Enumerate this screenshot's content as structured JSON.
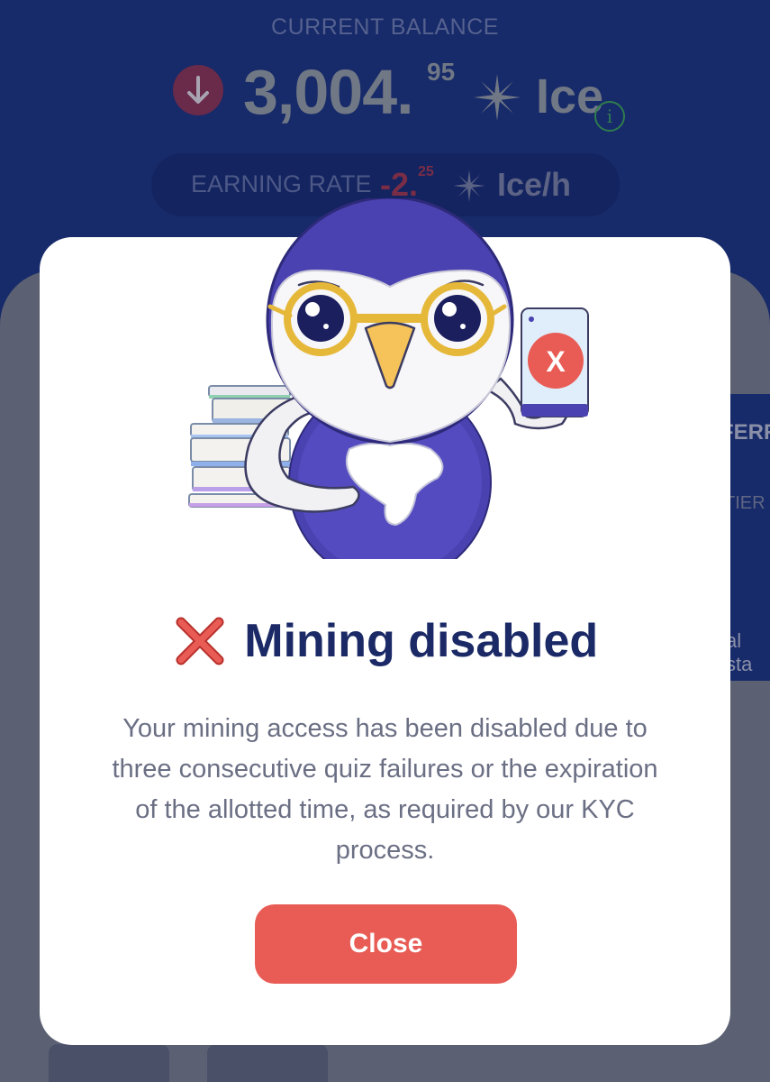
{
  "balance": {
    "label": "CURRENT BALANCE",
    "integer": "3,004.",
    "decimal": "95",
    "unit": "Ice",
    "trend": "down",
    "info_icon_glyph": "i"
  },
  "earning_rate": {
    "label": "EARNING RATE",
    "integer": "-2.",
    "decimal": "25",
    "unit": "Ice/h"
  },
  "background_card": {
    "heading_fragment": "FERR",
    "subheading_fragment": "TIER",
    "text_fragment": "al sta"
  },
  "modal": {
    "title_icon": "red-x-icon",
    "title": "Mining disabled",
    "message": "Your mining access has been disabled due to three consecutive quiz failures or the expiration of the allotted time, as required by our KYC process.",
    "close_label": "Close",
    "phone_glyph": "X"
  },
  "colors": {
    "background": "#172a69",
    "accent_red": "#e85c55",
    "title": "#1b2a66",
    "message": "#6b6f84"
  }
}
